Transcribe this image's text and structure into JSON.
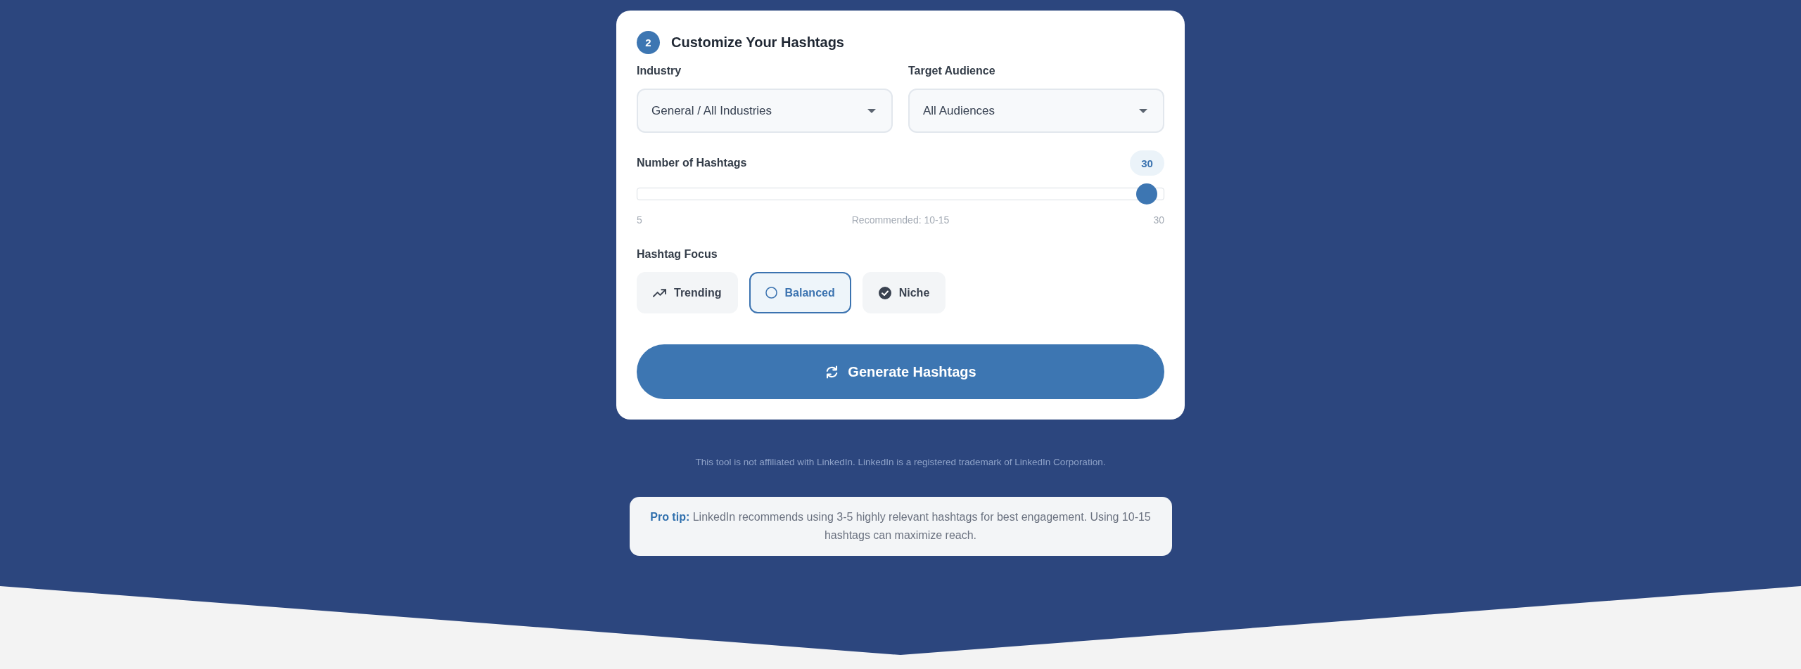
{
  "step": {
    "number": "2",
    "title": "Customize Your Hashtags"
  },
  "selects": [
    {
      "label": "Industry",
      "value": "General / All Industries"
    },
    {
      "label": "Target Audience",
      "value": "All Audiences"
    }
  ],
  "hashtag_count": {
    "label": "Number of Hashtags",
    "value": "30",
    "level": 1,
    "min_label": "5",
    "hint": "Recommended: 10-15",
    "max_label": "30"
  },
  "focus": {
    "label": "Hashtag Focus",
    "options": [
      {
        "label": "Trending",
        "kind": "trending",
        "selected": false
      },
      {
        "label": "Balanced",
        "kind": "balanced",
        "selected": true
      },
      {
        "label": "Niche",
        "kind": "niche",
        "selected": false
      }
    ]
  },
  "generate_button": {
    "label": "Generate Hashtags"
  },
  "disclaimer": "This tool is not affiliated with LinkedIn. LinkedIn is a registered trademark of LinkedIn Corporation.",
  "pro_tip": "**Pro tip:** LinkedIn recommends using 3-5 highly relevant hashtags for best engagement. Using 10-15 hashtags can maximize reach."
}
